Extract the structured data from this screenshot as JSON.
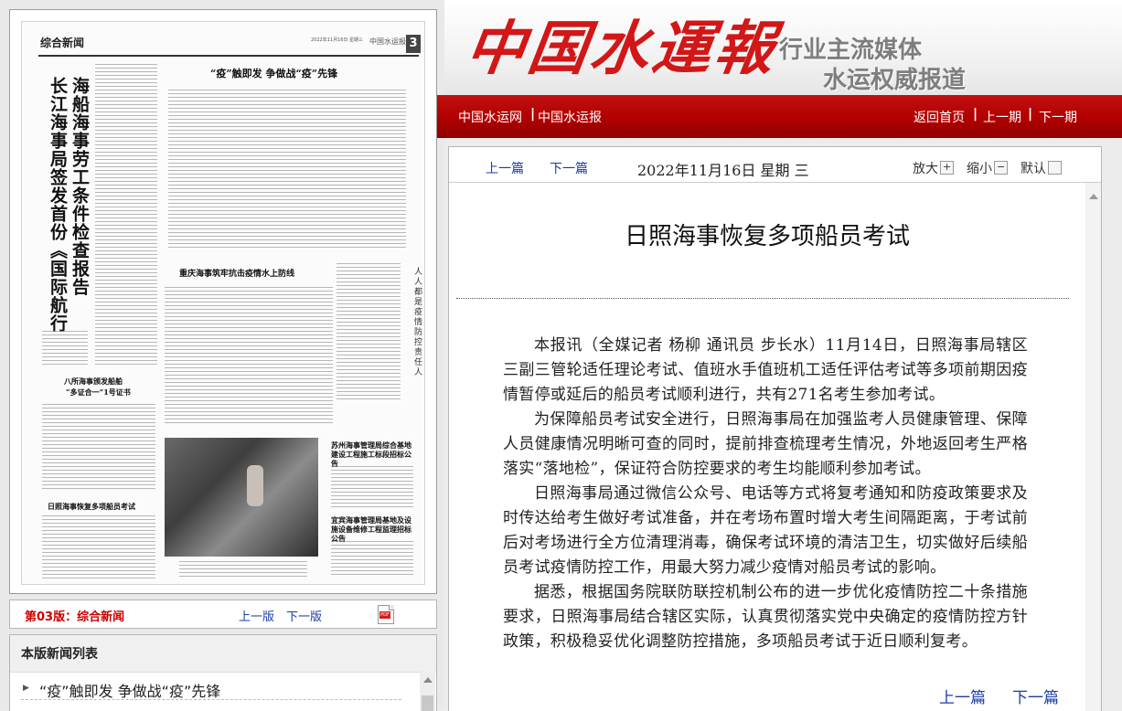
{
  "paper": {
    "section": "综合新闻",
    "page_number": "3",
    "masthead_small": "中国水运报",
    "date_small": "2022年11月16日 星期三",
    "headline_vertical_1": "海船海事劳工条件检查报告",
    "headline_vertical_2": "长江海事局签发首份《国际航行",
    "headline_top": "“疫”触即发 争做战“疫”先锋",
    "headline_mid": "重庆海事筑牢抗击疫情水上防线",
    "headline_left_1": "八所海事颁发船舶",
    "headline_left_2": "“多证合一”1号证书",
    "headline_left_3": "日照海事恢复多项船员考试",
    "slogan_vertical": "人人都是疫情防控责任人",
    "box_headline_1": "苏州海事管理局综合基地建设工程施工标段招标公告",
    "box_headline_2": "宜宾海事管理局基地及设施设备维修工程监理招标公告"
  },
  "edition_bar": {
    "title": "第03版：综合新闻",
    "prev_label": "上一版",
    "next_label": "下一版",
    "pdf_icon": "pdf-icon",
    "pdf_text": "PDF"
  },
  "news_list": {
    "title": "本版新闻列表",
    "items": [
      {
        "label": "“疫”触即发 争做战“疫”先锋"
      }
    ]
  },
  "header": {
    "logo_text": "中国水運報",
    "slogan_line1": "行业主流媒体",
    "slogan_line2": "水运权威报道"
  },
  "nav": {
    "site_link": "中国水运网",
    "paper_link": "中国水运报",
    "home_link": "返回首页",
    "prev_issue": "上一期",
    "next_issue": "下一期",
    "separator": "|"
  },
  "toolbar": {
    "prev_article": "上一篇",
    "next_article": "下一篇",
    "date": "2022年11月16日  星期 三",
    "zoom_in": "放大",
    "zoom_out": "缩小",
    "default": "默认"
  },
  "article": {
    "title": "日照海事恢复多项船员考试",
    "paragraphs": [
      "本报讯（全媒记者 杨柳 通讯员 步长水）11月14日，日照海事局辖区三副三管轮适任理论考试、值班水手值班机工适任评估考试等多项前期因疫情暂停或延后的船员考试顺利进行，共有271名考生参加考试。",
      "为保障船员考试安全进行，日照海事局在加强监考人员健康管理、保障人员健康情况明晰可查的同时，提前排查梳理考生情况，外地返回考生严格落实“落地检”，保证符合防控要求的考生均能顺利参加考试。",
      "日照海事局通过微信公众号、电话等方式将复考通知和防疫政策要求及时传达给考生做好考试准备，并在考场布置时增大考生间隔距离，于考试前后对考场进行全方位清理消毒，确保考试环境的清洁卫生，切实做好后续船员考试疫情防控工作，用最大努力减少疫情对船员考试的影响。",
      "据悉，根据国务院联防联控机制公布的进一步优化疫情防控二十条措施要求，日照海事局结合辖区实际，认真贯彻落实党中央确定的疫情防控方针政策，积极稳妥优化调整防控措施，多项船员考试于近日顺利复考。"
    ],
    "prev_label": "上一篇",
    "next_label": "下一篇"
  }
}
